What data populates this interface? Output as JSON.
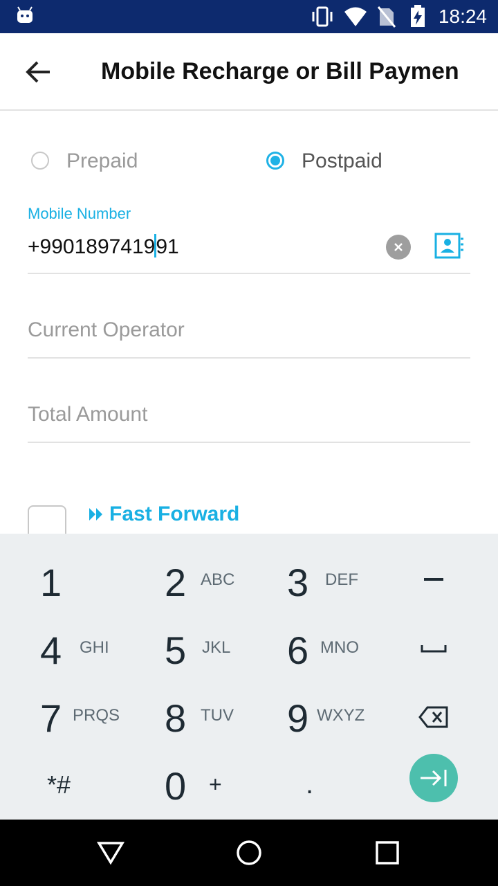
{
  "status_bar": {
    "time": "18:24",
    "icons": [
      "android-icon",
      "vibrate-icon",
      "wifi-icon",
      "no-sim-icon",
      "battery-charging-icon"
    ]
  },
  "app_bar": {
    "title": "Mobile Recharge or Bill Paymen",
    "back_icon": "arrow-left-icon"
  },
  "connection_type": {
    "options": [
      {
        "label": "Prepaid",
        "selected": false
      },
      {
        "label": "Postpaid",
        "selected": true
      }
    ]
  },
  "mobile_number": {
    "label": "Mobile Number",
    "value": "+9901897419",
    "value_after_cursor": "91"
  },
  "current_operator": {
    "placeholder": "Current Operator"
  },
  "total_amount": {
    "placeholder": "Total Amount"
  },
  "fast_forward": {
    "label": "Fast Forward"
  },
  "keypad": {
    "keys": [
      {
        "digit": "1",
        "letters": ""
      },
      {
        "digit": "2",
        "letters": "ABC"
      },
      {
        "digit": "3",
        "letters": "DEF"
      },
      {
        "digit": "4",
        "letters": "GHI"
      },
      {
        "digit": "5",
        "letters": "JKL"
      },
      {
        "digit": "6",
        "letters": "MNO"
      },
      {
        "digit": "7",
        "letters": "PRQS"
      },
      {
        "digit": "8",
        "letters": "TUV"
      },
      {
        "digit": "9",
        "letters": "WXYZ"
      },
      {
        "digit": "*#",
        "letters": ""
      },
      {
        "digit": "0",
        "letters": "+"
      },
      {
        "digit": ".",
        "letters": ""
      }
    ],
    "side_keys": [
      "minus-icon",
      "space-icon",
      "backspace-icon",
      "next-field-icon"
    ]
  },
  "colors": {
    "accent": "#19b0e3",
    "status_bar": "#0d2a6e",
    "keyboard_bg": "#eceff1",
    "next_button": "#4dbfad"
  }
}
